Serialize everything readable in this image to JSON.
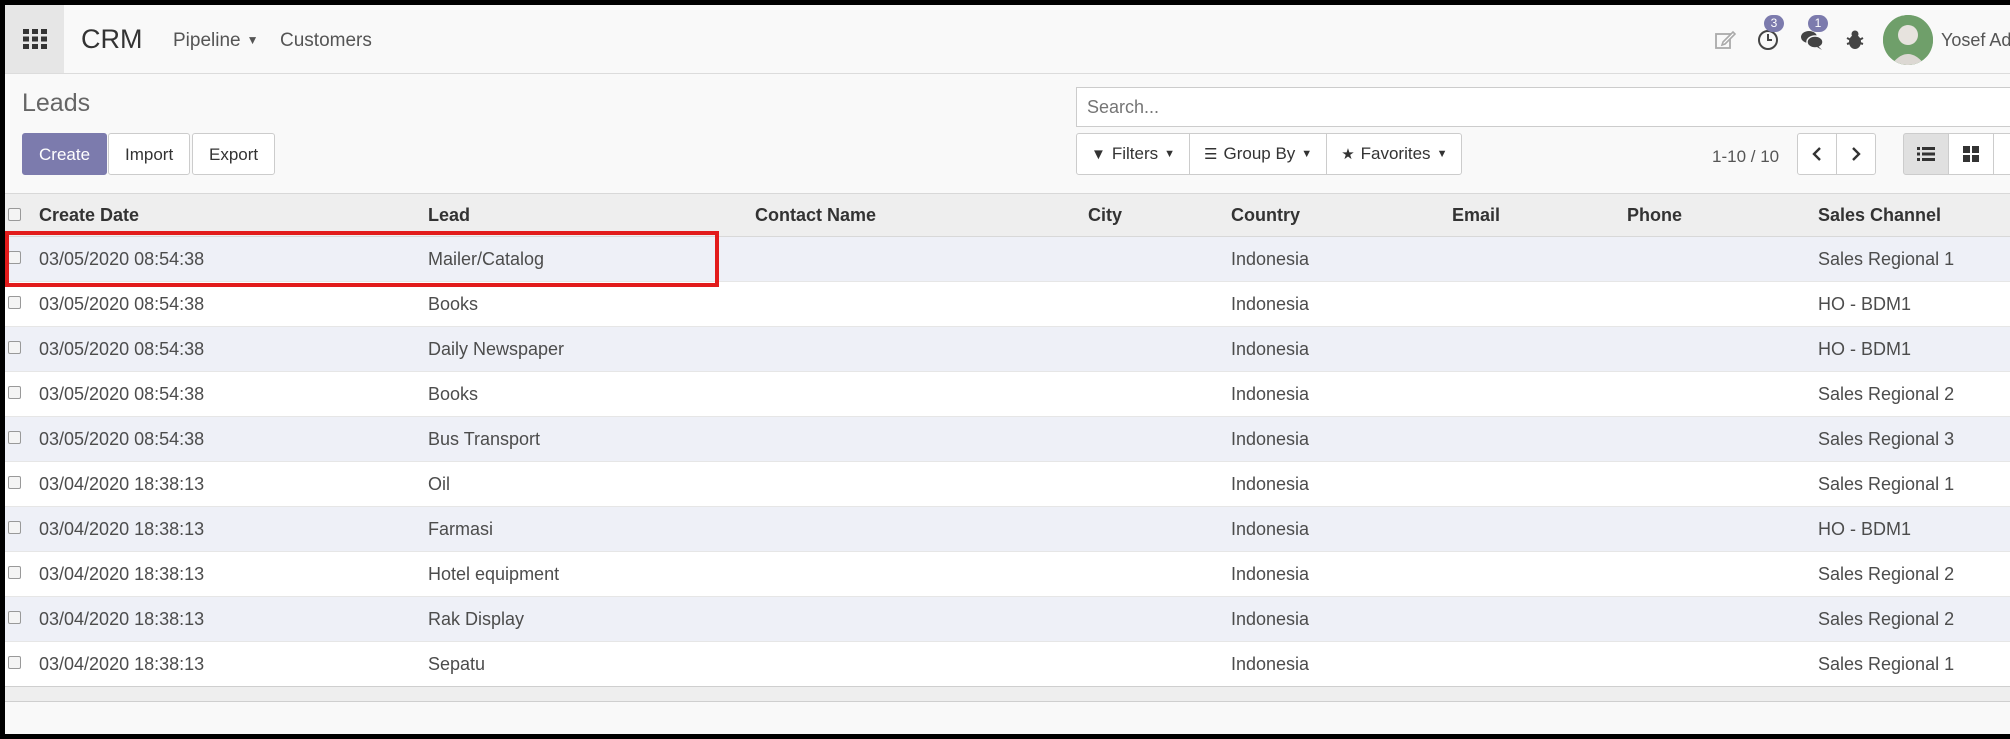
{
  "navbar": {
    "brand": "CRM",
    "menu": [
      {
        "label": "Pipeline",
        "has_dropdown": true
      },
      {
        "label": "Customers",
        "has_dropdown": false
      }
    ],
    "activity_count": "3",
    "message_count": "1",
    "user_name": "Yosef Ad"
  },
  "control": {
    "title": "Leads",
    "create_label": "Create",
    "import_label": "Import",
    "export_label": "Export",
    "search_placeholder": "Search...",
    "filters_label": "Filters",
    "group_by_label": "Group By",
    "favorites_label": "Favorites",
    "pager_value": "1-10 / 10"
  },
  "table": {
    "columns": [
      "Create Date",
      "Lead",
      "Contact Name",
      "City",
      "Country",
      "Email",
      "Phone",
      "Sales Channel"
    ],
    "rows": [
      {
        "create_date": "03/05/2020 08:54:38",
        "lead": "Mailer/Catalog",
        "contact": "",
        "city": "",
        "country": "Indonesia",
        "email": "",
        "phone": "",
        "channel": "Sales Regional 1"
      },
      {
        "create_date": "03/05/2020 08:54:38",
        "lead": "Books",
        "contact": "",
        "city": "",
        "country": "Indonesia",
        "email": "",
        "phone": "",
        "channel": "HO - BDM1"
      },
      {
        "create_date": "03/05/2020 08:54:38",
        "lead": "Daily Newspaper",
        "contact": "",
        "city": "",
        "country": "Indonesia",
        "email": "",
        "phone": "",
        "channel": "HO - BDM1"
      },
      {
        "create_date": "03/05/2020 08:54:38",
        "lead": "Books",
        "contact": "",
        "city": "",
        "country": "Indonesia",
        "email": "",
        "phone": "",
        "channel": "Sales Regional 2"
      },
      {
        "create_date": "03/05/2020 08:54:38",
        "lead": "Bus Transport",
        "contact": "",
        "city": "",
        "country": "Indonesia",
        "email": "",
        "phone": "",
        "channel": "Sales Regional 3"
      },
      {
        "create_date": "03/04/2020 18:38:13",
        "lead": "Oil",
        "contact": "",
        "city": "",
        "country": "Indonesia",
        "email": "",
        "phone": "",
        "channel": "Sales Regional 1"
      },
      {
        "create_date": "03/04/2020 18:38:13",
        "lead": "Farmasi",
        "contact": "",
        "city": "",
        "country": "Indonesia",
        "email": "",
        "phone": "",
        "channel": "HO - BDM1"
      },
      {
        "create_date": "03/04/2020 18:38:13",
        "lead": "Hotel equipment",
        "contact": "",
        "city": "",
        "country": "Indonesia",
        "email": "",
        "phone": "",
        "channel": "Sales Regional 2"
      },
      {
        "create_date": "03/04/2020 18:38:13",
        "lead": "Rak Display",
        "contact": "",
        "city": "",
        "country": "Indonesia",
        "email": "",
        "phone": "",
        "channel": "Sales Regional 2"
      },
      {
        "create_date": "03/04/2020 18:38:13",
        "lead": "Sepatu",
        "contact": "",
        "city": "",
        "country": "Indonesia",
        "email": "",
        "phone": "",
        "channel": "Sales Regional 1"
      }
    ]
  },
  "colors": {
    "accent": "#7c7bad",
    "highlight_box": "#e21b1b",
    "row_stripe": "#eef0f7"
  }
}
